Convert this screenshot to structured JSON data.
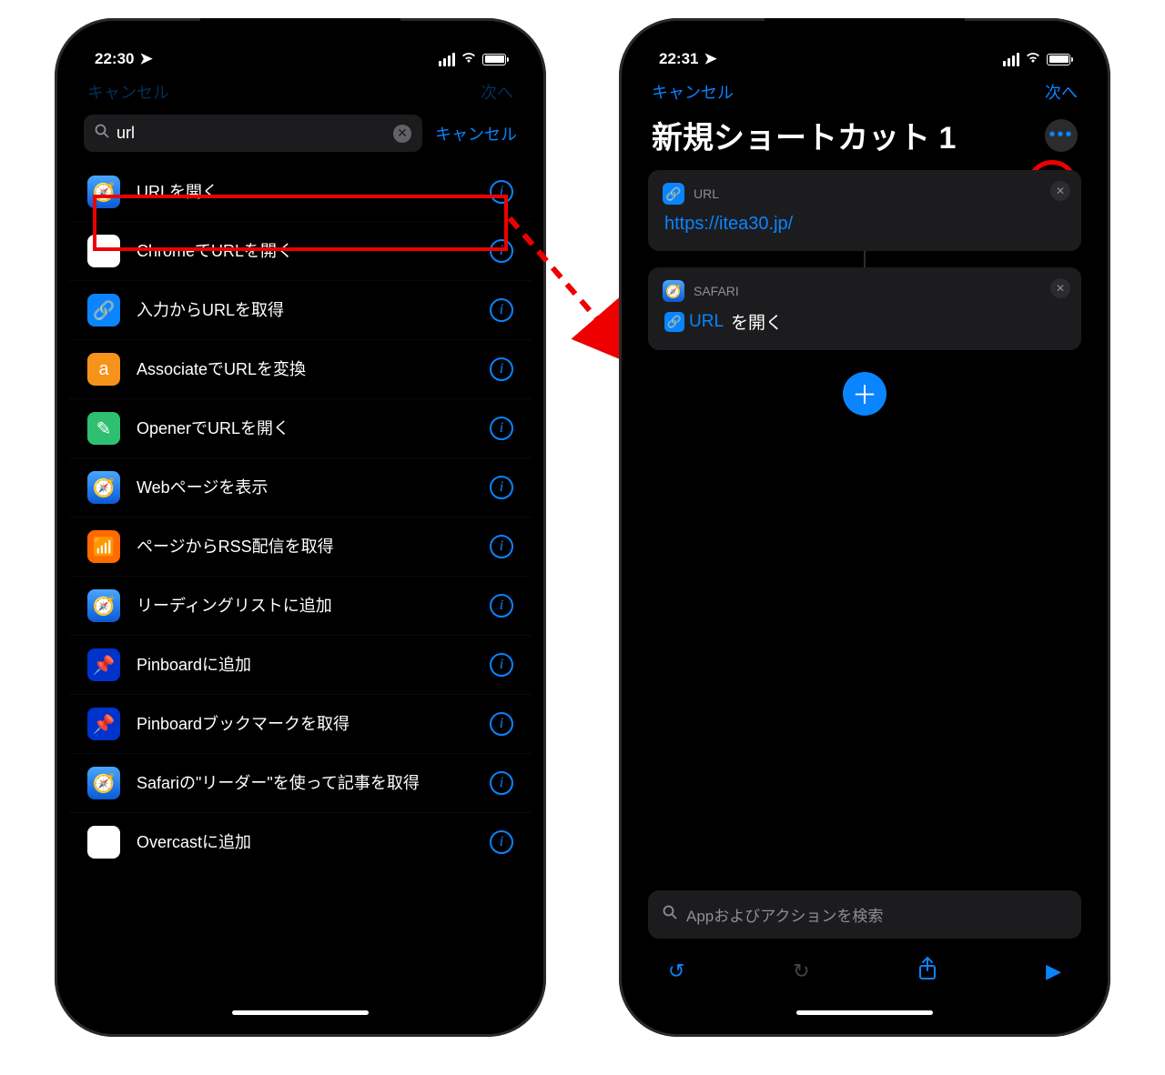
{
  "left": {
    "time": "22:30",
    "nav_cancel": "キャンセル",
    "nav_next": "次へ",
    "search_value": "url",
    "search_cancel": "キャンセル",
    "actions": [
      {
        "icon": "ico-safari",
        "glyph": "🧭",
        "label": "URLを開く"
      },
      {
        "icon": "ico-chrome",
        "glyph": "◐",
        "label": "ChromeでURLを開く"
      },
      {
        "icon": "ico-link",
        "glyph": "🔗",
        "label": "入力からURLを取得"
      },
      {
        "icon": "ico-assoc",
        "glyph": "a",
        "label": "AssociateでURLを変換"
      },
      {
        "icon": "ico-opener",
        "glyph": "✎",
        "label": "OpenerでURLを開く"
      },
      {
        "icon": "ico-safari",
        "glyph": "🧭",
        "label": "Webページを表示"
      },
      {
        "icon": "ico-rss",
        "glyph": "📶",
        "label": "ページからRSS配信を取得"
      },
      {
        "icon": "ico-safari",
        "glyph": "🧭",
        "label": "リーディングリストに追加"
      },
      {
        "icon": "ico-pinb",
        "glyph": "📌",
        "label": "Pinboardに追加"
      },
      {
        "icon": "ico-pinb",
        "glyph": "📌",
        "label": "Pinboardブックマークを取得"
      },
      {
        "icon": "ico-safari",
        "glyph": "🧭",
        "label": "Safariの\"リーダー\"を使って記事を取得"
      },
      {
        "icon": "ico-overc",
        "glyph": "◎",
        "label": "Overcastに追加"
      }
    ]
  },
  "right": {
    "time": "22:31",
    "nav_cancel": "キャンセル",
    "nav_next": "次へ",
    "title": "新規ショートカット 1",
    "url_card_label": "URL",
    "url_value": "https://itea30.jp/",
    "safari_card_label": "SAFARI",
    "open_pill_text": "URL",
    "open_tail": " を開く",
    "search_placeholder": "Appおよびアクションを検索"
  },
  "colors": {
    "accent": "#0a84ff",
    "annotation": "#ef0000"
  }
}
